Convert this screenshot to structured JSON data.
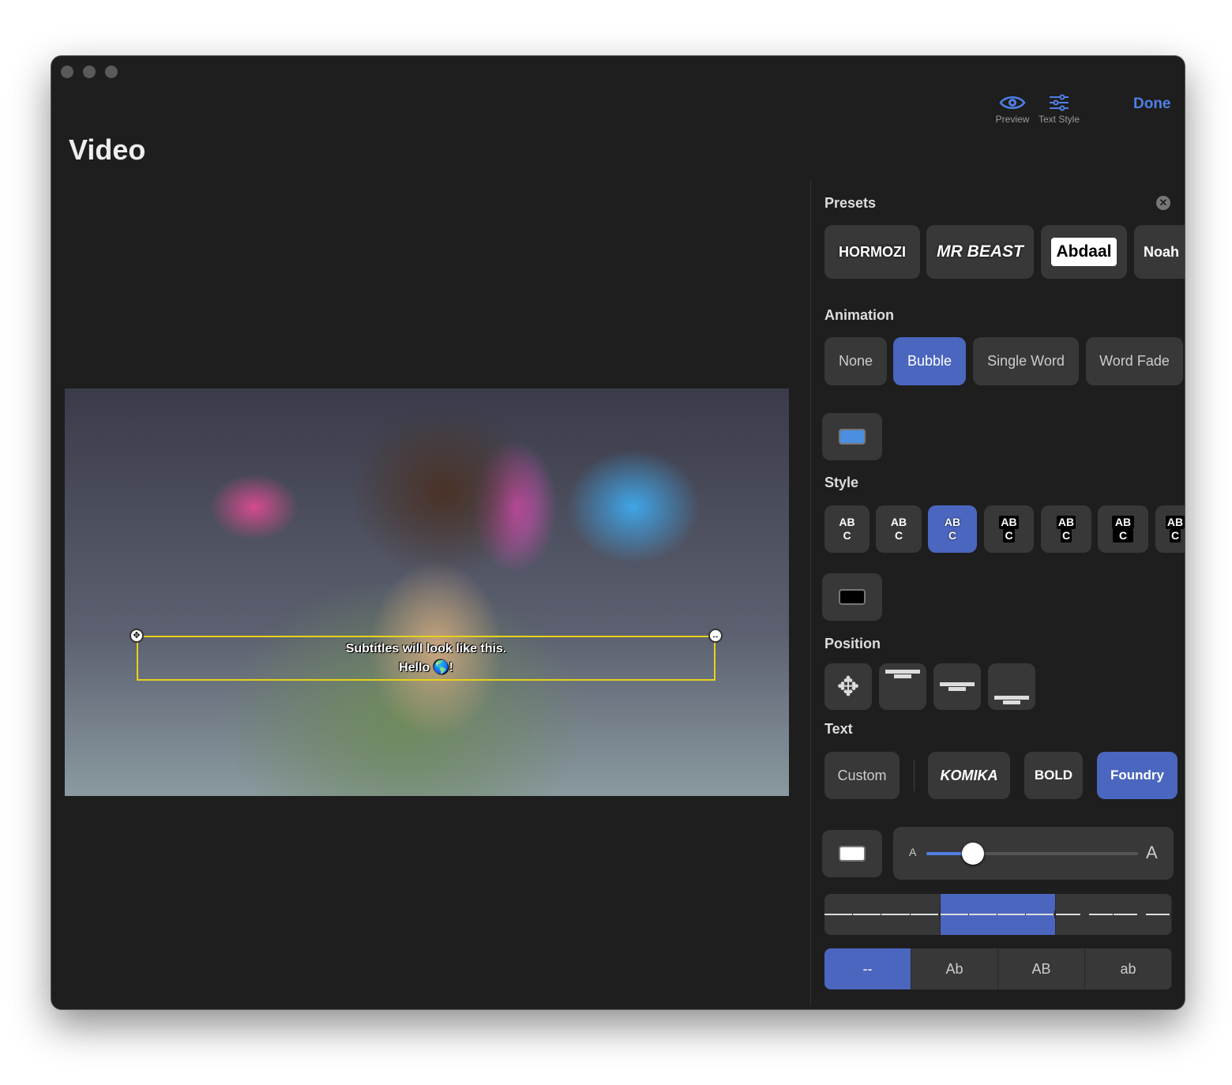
{
  "window": {
    "title": "Video"
  },
  "toolbar": {
    "preview_label": "Preview",
    "text_style_label": "Text Style",
    "done_label": "Done"
  },
  "video": {
    "subtitle_line1": "Subtitles will look like this.",
    "subtitle_line2": "Hello 🌎!"
  },
  "panel": {
    "presets_title": "Presets",
    "presets": [
      "HORMOZI",
      "MR BEAST",
      "Abdaal",
      "Noah"
    ],
    "animation_title": "Animation",
    "animations": [
      "None",
      "Bubble",
      "Single Word",
      "Word Fade"
    ],
    "animation_selected": "Bubble",
    "animation_color": "#4a8fe0",
    "style_title": "Style",
    "style_sample_top": "AB",
    "style_sample_bottom": "C",
    "style_selected_index": 2,
    "style_color": "#000000",
    "position_title": "Position",
    "text_title": "Text",
    "fonts": [
      "Custom",
      "KOMIKA",
      "BOLD",
      "Foundry"
    ],
    "font_selected": "Foundry",
    "text_color": "#ffffff",
    "size_small_label": "A",
    "size_large_label": "A",
    "size_value_percent": 22,
    "alignment_selected": "center",
    "case_options": [
      "--",
      "Ab",
      "AB",
      "ab"
    ],
    "case_selected": "--"
  },
  "colors": {
    "accent": "#4a66bf",
    "link": "#4f7fe6"
  }
}
